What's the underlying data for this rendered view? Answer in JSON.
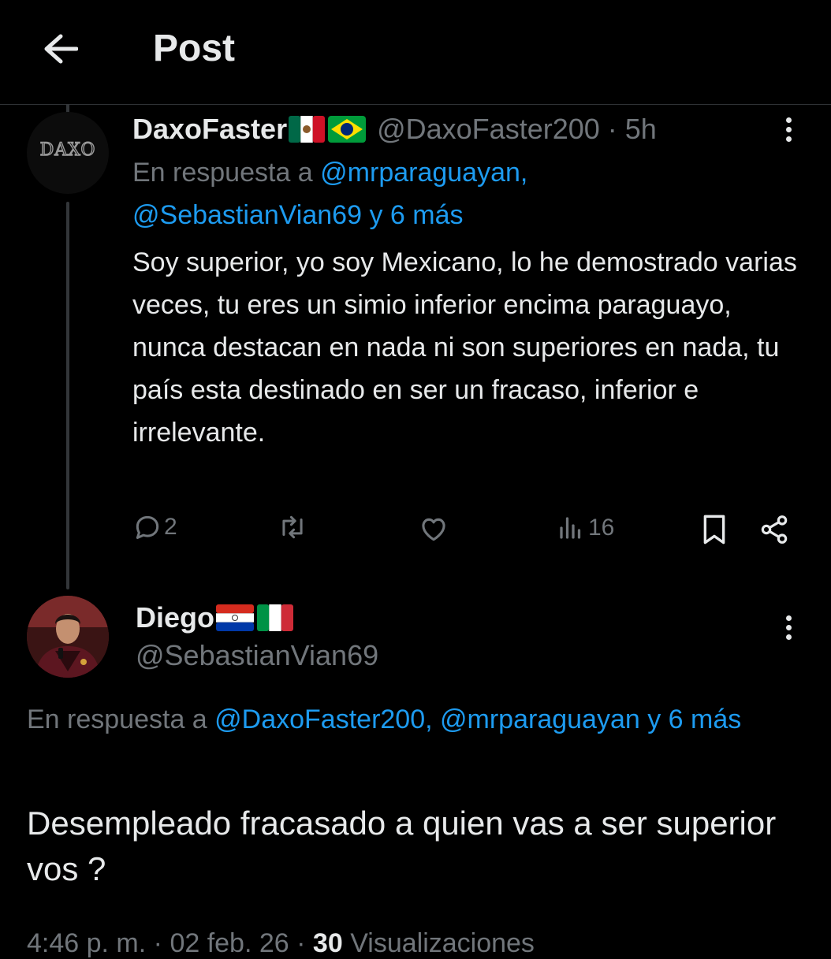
{
  "header": {
    "title": "Post"
  },
  "post1": {
    "avatar_text": "DAXO",
    "name": "DaxoFaster",
    "flags": [
      "mexico-flag",
      "brazil-flag"
    ],
    "handle": "@DaxoFaster200",
    "separator": "·",
    "time": "5h",
    "reply_prefix": "En respuesta a",
    "reply_to_1": "@mrparaguayan,",
    "reply_to_2": "@SebastianVian69 y 6 más",
    "text": "Soy superior, yo soy Mexicano, lo he demostrado varias veces, tu eres un simio inferior encima paraguayo, nunca destacan en nada ni son superiores en nada, tu país esta destinado en ser un fracaso, inferior e irrelevante.",
    "reply_count": "2",
    "views": "16"
  },
  "post2": {
    "name": "Diego",
    "flags": [
      "paraguay-flag",
      "italy-flag"
    ],
    "handle": "@SebastianVian69",
    "reply_prefix": "En respuesta a",
    "reply_to": "@DaxoFaster200, @mrparaguayan y 6 más",
    "text": "Desempleado fracasado a quien vas a ser superior vos ?"
  },
  "footer": {
    "time": "4:46 p. m.",
    "sep1": "·",
    "date": "02 feb. 26",
    "sep2": "·",
    "views_count": "30",
    "views_label": "Visualizaciones"
  },
  "colors": {
    "background": "#000000",
    "text": "#e7e9ea",
    "muted": "#71767b",
    "link": "#1d9bf0"
  }
}
